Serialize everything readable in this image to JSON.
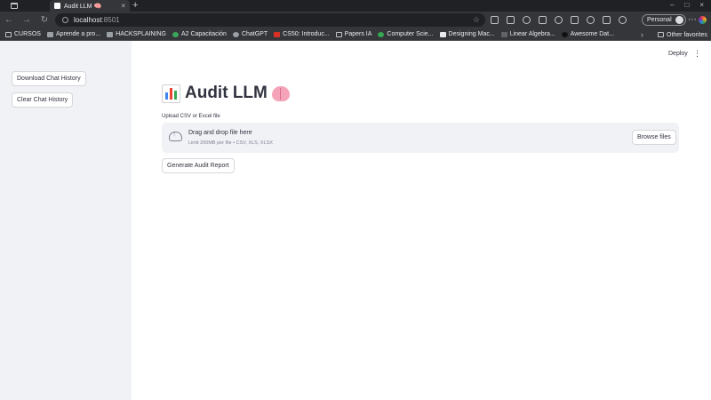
{
  "browser": {
    "tab_title": "Audit LLM 🧠",
    "url_host": "localhost",
    "url_port": ":8501",
    "profile_name": "Personal"
  },
  "bookmarks": [
    {
      "label": "CURSOS",
      "icon": "folder-icon"
    },
    {
      "label": "Aprende a pro...",
      "icon": "site-icon"
    },
    {
      "label": "HACKSPLAINING",
      "icon": "site-icon"
    },
    {
      "label": "A2 Capacitación",
      "icon": "site-icon"
    },
    {
      "label": "ChatGPT",
      "icon": "site-icon"
    },
    {
      "label": "CS50: Introduc...",
      "icon": "site-icon"
    },
    {
      "label": "Papers IA",
      "icon": "folder-icon"
    },
    {
      "label": "Computer Scie...",
      "icon": "site-icon"
    },
    {
      "label": "Designing Mac...",
      "icon": "site-icon"
    },
    {
      "label": "Linear Algebra...",
      "icon": "site-icon"
    },
    {
      "label": "Awesome Dat...",
      "icon": "site-icon"
    }
  ],
  "bookmarks_other": "Other favorites",
  "sidebar": {
    "download_label": "Download Chat History",
    "clear_label": "Clear Chat History"
  },
  "header": {
    "deploy_label": "Deploy",
    "menu_glyph": "⋮"
  },
  "main": {
    "title": "Audit LLM",
    "upload_label": "Upload CSV or Excel file",
    "drop_main": "Drag and drop file here",
    "drop_sub": "Limit 200MB per file • CSV, XLS, XLSX",
    "browse_label": "Browse files",
    "generate_label": "Generate Audit Report"
  },
  "colors": {
    "sidebar_bg": "#f0f2f6",
    "text": "#31333f",
    "muted": "#808495",
    "chrome_dark": "#202124",
    "chrome_toolbar": "#35363a"
  }
}
